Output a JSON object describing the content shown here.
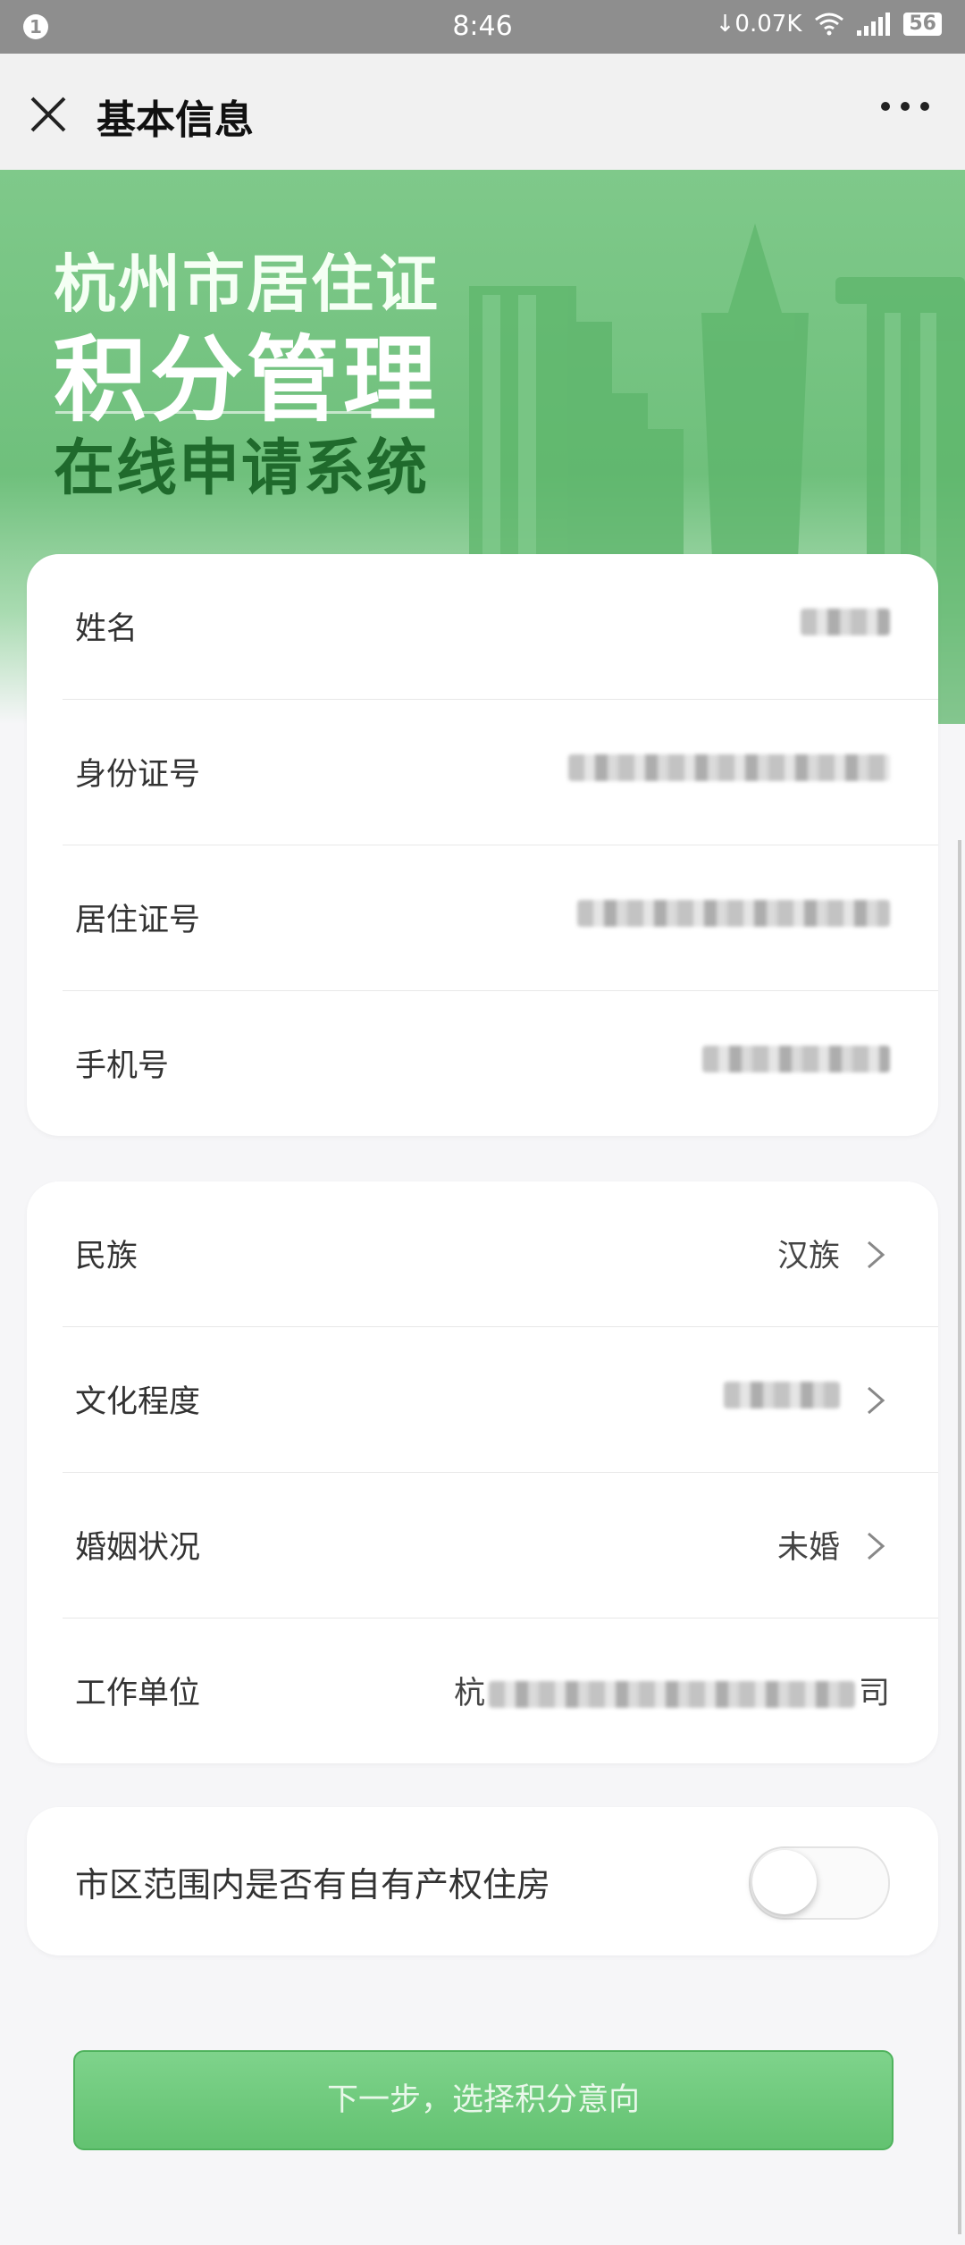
{
  "status_bar": {
    "notification_badge": "1",
    "time": "8:46",
    "network_speed": "↓0.07K",
    "battery": "56"
  },
  "header": {
    "title": "基本信息"
  },
  "banner": {
    "line1": "杭州市居住证",
    "line2": "积分管理",
    "line3": "在线申请系统"
  },
  "personal_info": {
    "rows": [
      {
        "label": "姓名",
        "value": ""
      },
      {
        "label": "身份证号",
        "value": ""
      },
      {
        "label": "居住证号",
        "value": ""
      },
      {
        "label": "手机号",
        "value": ""
      }
    ]
  },
  "detail_info": {
    "rows": [
      {
        "label": "民族",
        "value": "汉族"
      },
      {
        "label": "文化程度",
        "value": ""
      },
      {
        "label": "婚姻状况",
        "value": "未婚"
      },
      {
        "label": "工作单位",
        "value_prefix": "杭",
        "value_suffix": "司"
      }
    ]
  },
  "housing": {
    "label": "市区范围内是否有自有产权住房",
    "toggle_on": false
  },
  "next_button": {
    "label": "下一步，选择积分意向"
  },
  "colors": {
    "accent": "#63c271",
    "banner": "#7fc98a",
    "banner_dark_text": "#1f6a2c"
  }
}
